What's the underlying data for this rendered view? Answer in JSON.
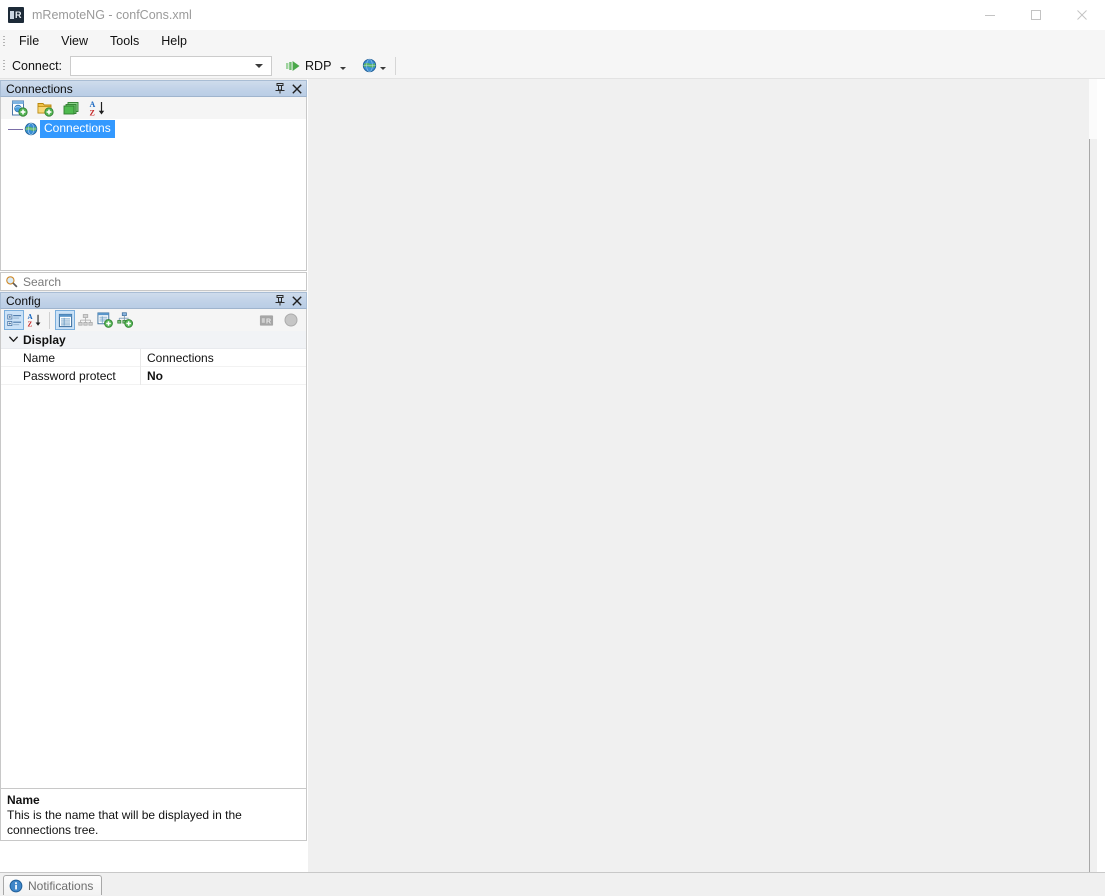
{
  "window": {
    "title": "mRemoteNG - confCons.xml",
    "icon": "mremoteng-logo-icon",
    "controls": [
      {
        "name": "minimize-button",
        "glyph": "minimize-icon"
      },
      {
        "name": "maximize-button",
        "glyph": "maximize-icon"
      },
      {
        "name": "close-button",
        "glyph": "close-icon"
      }
    ]
  },
  "menubar": {
    "items": [
      {
        "label": "File"
      },
      {
        "label": "View"
      },
      {
        "label": "Tools"
      },
      {
        "label": "Help"
      }
    ]
  },
  "toolbar": {
    "connect_label": "Connect:",
    "connect_value": "",
    "connect_placeholder": "",
    "protocol_label": "RDP",
    "protocol_icon": "rdp-arrow-icon",
    "quickconnect_icon": "globe-icon"
  },
  "connections_panel": {
    "title": "Connections",
    "pin_icon": "pin-icon",
    "close_icon": "close-icon",
    "toolbar": [
      {
        "name": "new-connection-button",
        "icon": "new-connection-icon"
      },
      {
        "name": "new-folder-button",
        "icon": "new-folder-icon"
      },
      {
        "name": "view-windows-button",
        "icon": "stacked-windows-icon"
      },
      {
        "name": "sort-az-button",
        "icon": "sort-alpha-down-icon"
      }
    ],
    "tree": [
      {
        "label": "Connections",
        "icon": "globe-icon",
        "selected": true
      }
    ],
    "search_placeholder": "Search",
    "search_value": "",
    "search_icon": "search-icon"
  },
  "config_panel": {
    "title": "Config",
    "pin_icon": "pin-icon",
    "close_icon": "close-icon",
    "toolbar": [
      {
        "name": "categorized-button",
        "icon": "categorized-icon",
        "pressed": true
      },
      {
        "name": "sort-alphabetical-button",
        "icon": "sort-alpha-down-icon",
        "pressed": false
      },
      {
        "name": "property-pages-button",
        "icon": "property-grid-icon",
        "pressed": true
      },
      {
        "name": "inheritance-button",
        "icon": "hierarchy-icon",
        "pressed": false,
        "disabled": true
      },
      {
        "name": "default-properties-button",
        "icon": "default-properties-icon",
        "pressed": false
      },
      {
        "name": "default-inheritance-button",
        "icon": "default-inheritance-icon",
        "pressed": false
      }
    ],
    "right_tools": [
      {
        "name": "mremoteng-button",
        "icon": "mremoteng-badge-icon",
        "disabled": true
      },
      {
        "name": "status-indicator",
        "icon": "circle-icon",
        "disabled": true
      }
    ],
    "properties": {
      "category": "Display",
      "rows": [
        {
          "name": "Name",
          "value": "Connections",
          "bold": false
        },
        {
          "name": "Password protect",
          "value": "No",
          "bold": true
        }
      ]
    },
    "description": {
      "title": "Name",
      "body": "This is the name that will be displayed in the connections tree."
    }
  },
  "bottom": {
    "notifications_tab": "Notifications",
    "notifications_icon": "info-icon"
  },
  "colors": {
    "selection_blue": "#3399ff",
    "panel_header": "#c2d3e8",
    "mdi_background": "#f0f0f0",
    "accent_green": "#3c9e3c"
  }
}
